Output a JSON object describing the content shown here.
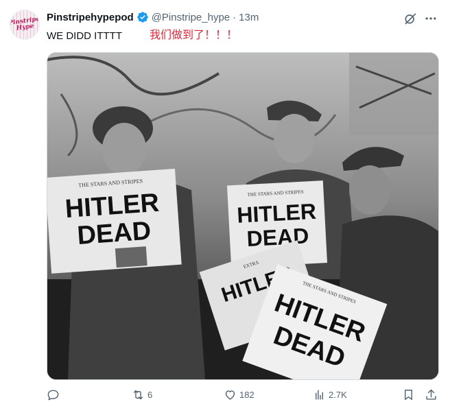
{
  "tweet": {
    "avatar_text": "Pinstripe Hype",
    "display_name": "Pinstripehypepod",
    "handle": "@Pinstripe_hype",
    "separator": "·",
    "time": "13m",
    "annotation": "我们做到了！！！",
    "text": "WE DIDD ITTTT"
  },
  "media": {
    "newspaper_masthead": "THE STARS AND STRIPES",
    "newspaper_edition": "EXTRA",
    "headline_line1": "HITLER",
    "headline_line2": "DEAD"
  },
  "actions": {
    "reply_icon": "reply-icon",
    "retweet_count": "6",
    "like_count": "182",
    "views_count": "2.7K",
    "bookmark_icon": "bookmark-icon",
    "share_icon": "share-icon"
  },
  "colors": {
    "verified_blue": "#1d9bf0",
    "secondary_text": "#536471",
    "annotation_red": "#e0243a"
  }
}
